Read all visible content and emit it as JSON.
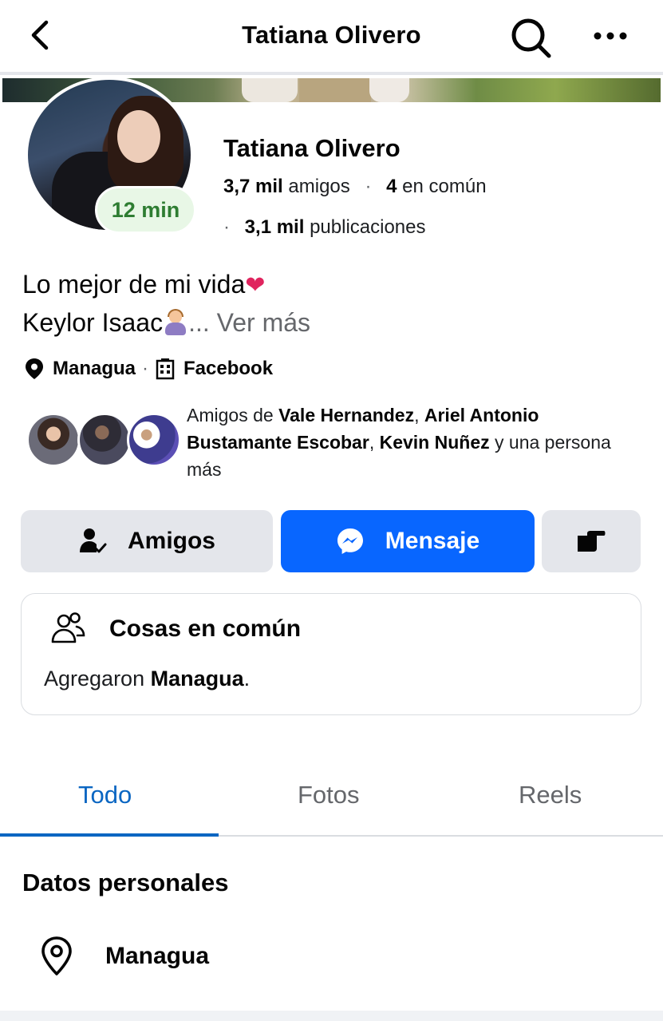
{
  "header": {
    "title": "Tatiana Olivero"
  },
  "profile": {
    "name": "Tatiana Olivero",
    "active_badge": "12 min",
    "friends_count": "3,7 mil",
    "friends_label": "amigos",
    "common_count": "4",
    "common_label": "en común",
    "posts_count": "3,1 mil",
    "posts_label": "publicaciones"
  },
  "bio": {
    "line1": "Lo mejor de mi vida",
    "line2": "Keylor Isaac",
    "more": "... Ver más"
  },
  "details": {
    "location": "Managua",
    "work": "Facebook"
  },
  "mutual": {
    "prefix": "Amigos de ",
    "friend1": "Vale Hernandez",
    "sep1": ", ",
    "friend2": "Ariel Antonio Bustamante Escobar",
    "sep2": ", ",
    "friend3": "Kevin Nuñez",
    "suffix": " y una persona más"
  },
  "actions": {
    "friends_label": "Amigos",
    "message_label": "Mensaje"
  },
  "common_card": {
    "title": "Cosas en común",
    "text_prefix": "Agregaron ",
    "text_bold": "Managua",
    "text_suffix": "."
  },
  "tabs": [
    {
      "label": "Todo",
      "active": true
    },
    {
      "label": "Fotos",
      "active": false
    },
    {
      "label": "Reels",
      "active": false
    }
  ],
  "personal": {
    "title": "Datos personales",
    "location": "Managua"
  },
  "colors": {
    "accent": "#0866ff",
    "tab_active": "#0a66c2",
    "badge_green": "#2e7d32"
  }
}
